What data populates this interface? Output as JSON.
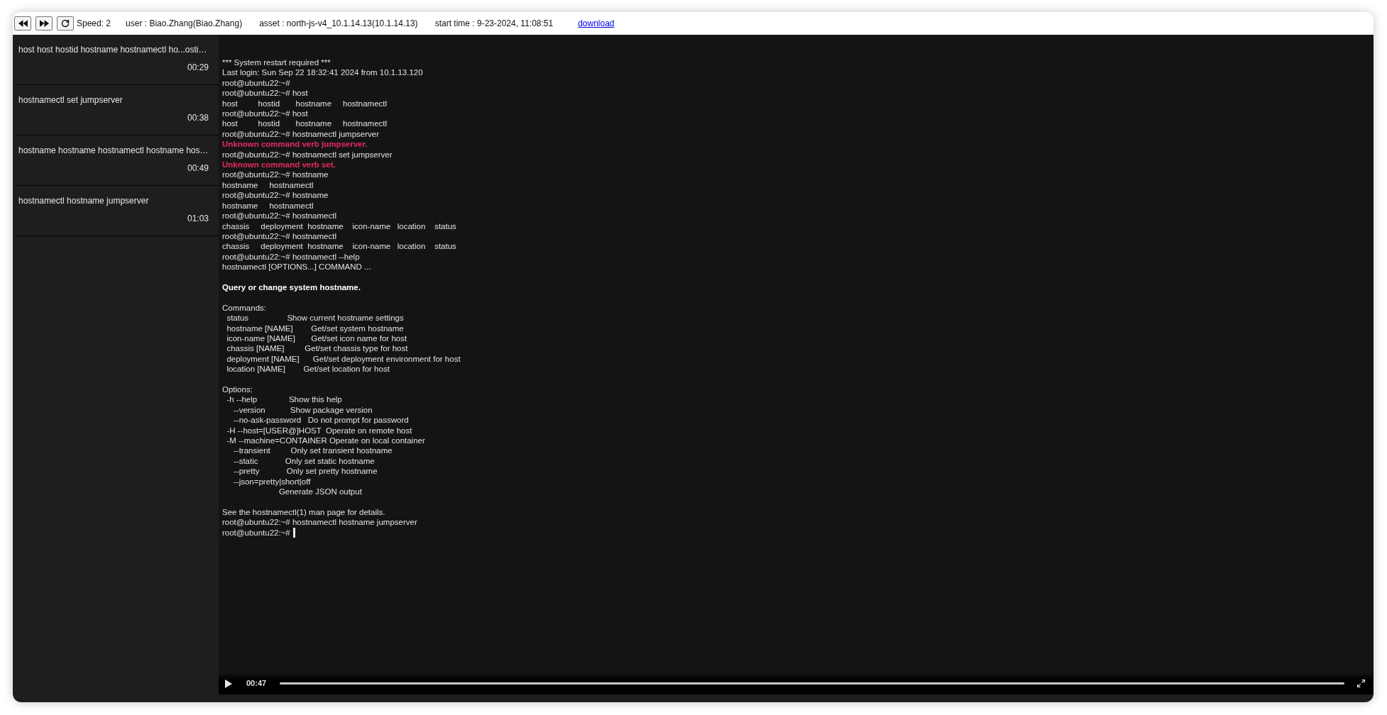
{
  "toolbar": {
    "speed": "Speed: 2",
    "user": "user : Biao.Zhang(Biao.Zhang)",
    "asset": "asset : north-js-v4_10.1.14.13(10.1.14.13)",
    "start_time": "start time : 9-23-2024, 11:08:51",
    "download_link": "download"
  },
  "commands": [
    {
      "text": "host host hostid hostname hostnamectl ho...osti…",
      "time": "00:29"
    },
    {
      "text": "hostnamectl set jumpserver",
      "time": "00:38"
    },
    {
      "text": "hostname hostname hostnamectl hostname hos…",
      "time": "00:49"
    },
    {
      "text": "hostnamectl hostname jumpserver",
      "time": "01:03"
    }
  ],
  "terminal": {
    "lines": [
      {
        "kind": "output",
        "text": "*** System restart required ***"
      },
      {
        "kind": "output",
        "text": "Last login: Sun Sep 22 18:32:41 2024 from 10.1.13.120"
      },
      {
        "kind": "output",
        "text": "root@ubuntu22:~#"
      },
      {
        "kind": "output",
        "text": "root@ubuntu22:~# host"
      },
      {
        "kind": "output",
        "text": "host         hostid       hostname     hostnamectl"
      },
      {
        "kind": "output",
        "text": "root@ubuntu22:~# host"
      },
      {
        "kind": "output",
        "text": "host         hostid       hostname     hostnamectl"
      },
      {
        "kind": "output",
        "text": "root@ubuntu22:~# hostnamectl jumpserver"
      },
      {
        "kind": "error",
        "text": "Unknown command verb jumpserver."
      },
      {
        "kind": "output",
        "text": "root@ubuntu22:~# hostnamectl set jumpserver"
      },
      {
        "kind": "error",
        "text": "Unknown command verb set."
      },
      {
        "kind": "output",
        "text": "root@ubuntu22:~# hostname"
      },
      {
        "kind": "output",
        "text": "hostname     hostnamectl"
      },
      {
        "kind": "output",
        "text": "root@ubuntu22:~# hostname"
      },
      {
        "kind": "output",
        "text": "hostname     hostnamectl"
      },
      {
        "kind": "output",
        "text": "root@ubuntu22:~# hostnamectl"
      },
      {
        "kind": "output",
        "text": "chassis     deployment  hostname    icon-name   location    status"
      },
      {
        "kind": "output",
        "text": "root@ubuntu22:~# hostnamectl"
      },
      {
        "kind": "output",
        "text": "chassis     deployment  hostname    icon-name   location    status"
      },
      {
        "kind": "output",
        "text": "root@ubuntu22:~# hostnamectl --help"
      },
      {
        "kind": "output",
        "text": "hostnamectl [OPTIONS...] COMMAND ..."
      },
      {
        "kind": "blank"
      },
      {
        "kind": "bold",
        "text": "Query or change system hostname."
      },
      {
        "kind": "blank"
      },
      {
        "kind": "output",
        "text": "Commands:"
      },
      {
        "kind": "output",
        "text": "  status                 Show current hostname settings"
      },
      {
        "kind": "output",
        "text": "  hostname [NAME]        Get/set system hostname"
      },
      {
        "kind": "output",
        "text": "  icon-name [NAME]       Get/set icon name for host"
      },
      {
        "kind": "output",
        "text": "  chassis [NAME]         Get/set chassis type for host"
      },
      {
        "kind": "output",
        "text": "  deployment [NAME]      Get/set deployment environment for host"
      },
      {
        "kind": "output",
        "text": "  location [NAME]        Get/set location for host"
      },
      {
        "kind": "blank"
      },
      {
        "kind": "output",
        "text": "Options:"
      },
      {
        "kind": "output",
        "text": "  -h --help              Show this help"
      },
      {
        "kind": "output",
        "text": "     --version           Show package version"
      },
      {
        "kind": "output",
        "text": "     --no-ask-password   Do not prompt for password"
      },
      {
        "kind": "output",
        "text": "  -H --host=[USER@]HOST  Operate on remote host"
      },
      {
        "kind": "output",
        "text": "  -M --machine=CONTAINER Operate on local container"
      },
      {
        "kind": "output",
        "text": "     --transient         Only set transient hostname"
      },
      {
        "kind": "output",
        "text": "     --static            Only set static hostname"
      },
      {
        "kind": "output",
        "text": "     --pretty            Only set pretty hostname"
      },
      {
        "kind": "output",
        "text": "     --json=pretty|short|off"
      },
      {
        "kind": "output",
        "text": "                         Generate JSON output"
      },
      {
        "kind": "blank"
      },
      {
        "kind": "output",
        "text": "See the hostnamectl(1) man page for details."
      },
      {
        "kind": "output",
        "text": "root@ubuntu22:~# hostnamectl hostname jumpserver"
      },
      {
        "kind": "cursor",
        "text": "root@ubuntu22:~#"
      }
    ]
  },
  "player": {
    "playing": false,
    "time": "00:47"
  }
}
